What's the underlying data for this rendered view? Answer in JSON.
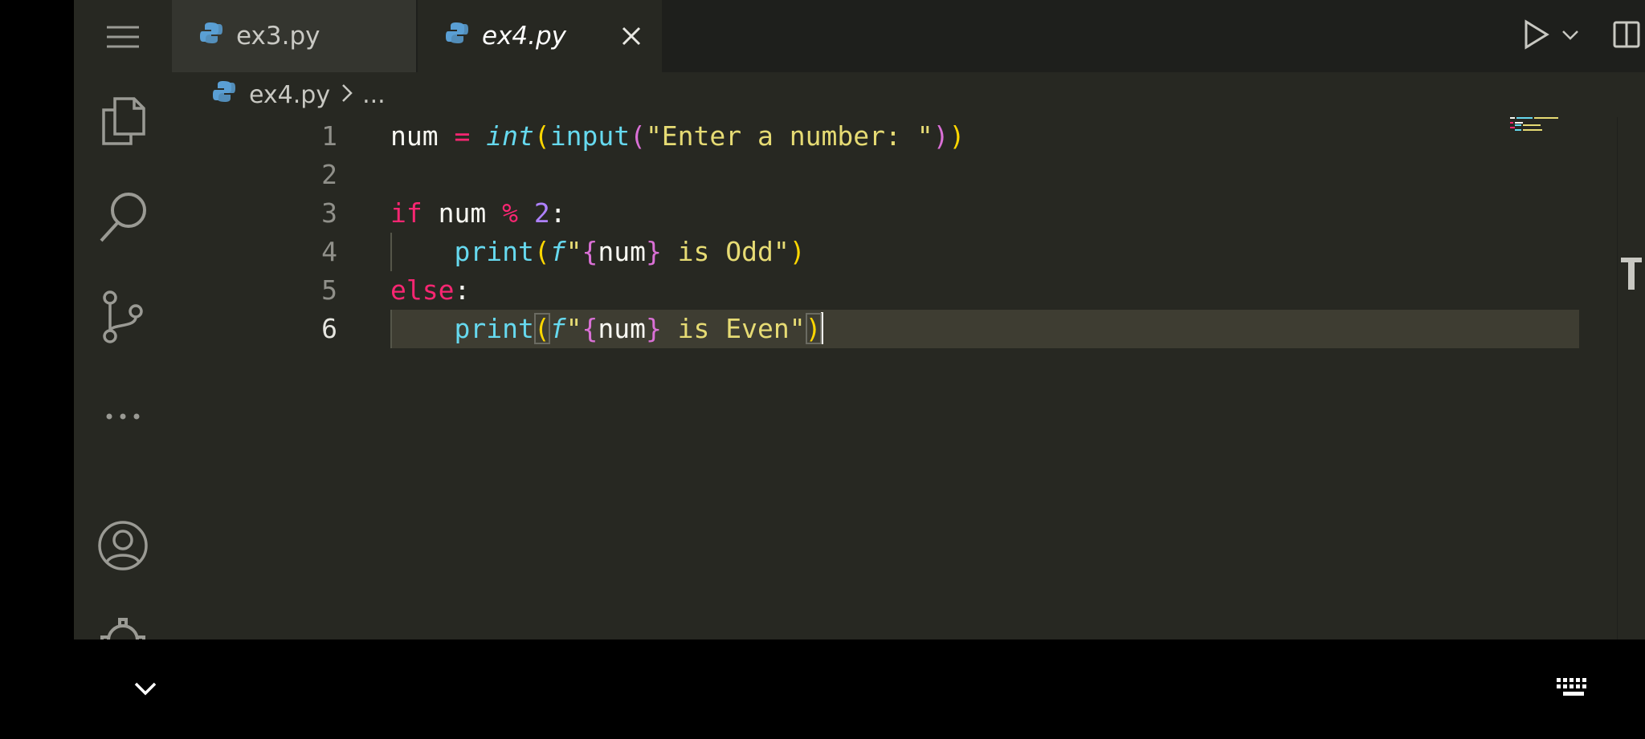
{
  "tabs": [
    {
      "label": "ex3.py",
      "active": false,
      "icon": "python-icon"
    },
    {
      "label": "ex4.py",
      "active": true,
      "icon": "python-icon",
      "close_icon": "close-icon"
    }
  ],
  "toolbar": {
    "run_icon": "play-icon",
    "run_dropdown_icon": "chevron-down-icon",
    "split_icon": "split-editor-icon",
    "more_icon": "more-actions-icon"
  },
  "breadcrumb": {
    "file": "ex4.py",
    "separator_icon": "chevron-right-icon",
    "more": "..."
  },
  "activity_bar": [
    "menu-icon",
    "explorer-icon",
    "search-icon",
    "source-control-icon",
    "more-icon",
    "account-icon",
    "settings-gear-icon"
  ],
  "editor": {
    "line_numbers": [
      "1",
      "2",
      "3",
      "4",
      "5",
      "6"
    ],
    "current_line": 6,
    "code": {
      "l1": {
        "var": "num",
        "op": "=",
        "fn1": "int",
        "p1": "(",
        "fn2": "input",
        "p2": "(",
        "str": "\"Enter a number: \"",
        "p3": ")",
        "p4": ")"
      },
      "l3": {
        "kw": "if",
        "var": "num",
        "op": "%",
        "num": "2",
        "colon": ":"
      },
      "l4": {
        "indent": "    ",
        "fn": "print",
        "p1": "(",
        "f": "f",
        "q1": "\"",
        "b1": "{",
        "var": "num",
        "b2": "}",
        "text": " is Odd\"",
        "p2": ")"
      },
      "l5": {
        "kw": "else",
        "colon": ":"
      },
      "l6": {
        "indent": "    ",
        "fn": "print",
        "p1": "(",
        "f": "f",
        "q1": "\"",
        "b1": "{",
        "var": "num",
        "b2": "}",
        "text": " is Even\"",
        "p2": ")"
      }
    }
  },
  "colors": {
    "background": "#272822",
    "keyword": "#f92672",
    "function": "#66d9ef",
    "string": "#e6db74",
    "number": "#ae81ff"
  },
  "bottom_bar": {
    "collapse_icon": "chevron-down-icon",
    "keyboard_icon": "keyboard-icon"
  }
}
